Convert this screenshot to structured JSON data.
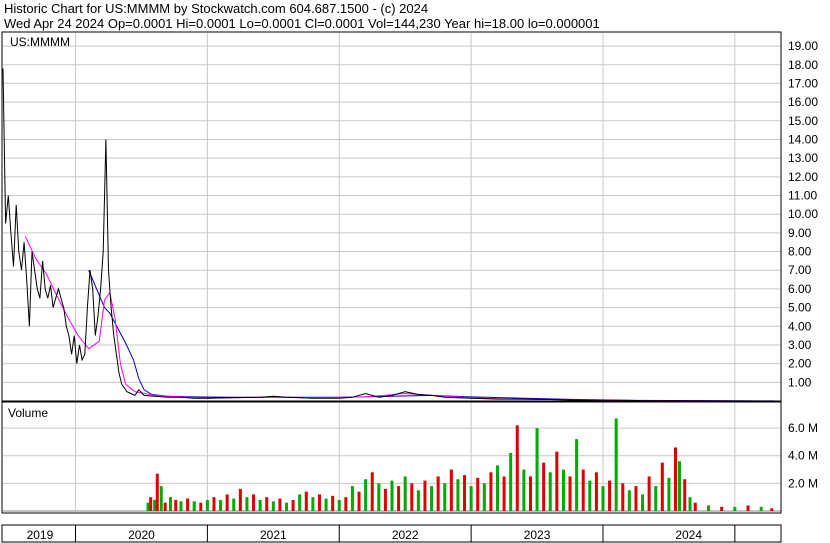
{
  "header": {
    "line1": "Historic Chart for US:MMMM by Stockwatch.com 604.687.1500 - (c) 2024",
    "line2": "Wed Apr 24 2024   Op=0.0001  Hi=0.0001  Lo=0.0001  Cl=0.0001  Vol=144,230   Year hi=18.00   lo=0.000001"
  },
  "chart_data": {
    "type": "line",
    "symbol_label": "US:MMMM",
    "volume_label": "Volume",
    "colors": {
      "price": "#000000",
      "ma_short": "#ff00ff",
      "ma_long": "#0000cc",
      "volume_up": "#00aa00",
      "volume_down": "#dd0000",
      "grid": "#c8c8c8"
    },
    "price_axis": {
      "ylim": [
        0,
        19.7
      ],
      "ticks": [
        "19.00",
        "18.00",
        "17.00",
        "16.00",
        "15.00",
        "14.00",
        "13.00",
        "12.00",
        "11.00",
        "10.00",
        "9.00",
        "8.00",
        "7.00",
        "6.00",
        "5.00",
        "4.00",
        "3.00",
        "2.00",
        "1.00"
      ],
      "tick_values": [
        19,
        18,
        17,
        16,
        15,
        14,
        13,
        12,
        11,
        10,
        9,
        8,
        7,
        6,
        5,
        4,
        3,
        2,
        1
      ]
    },
    "volume_axis": {
      "ylim": [
        0,
        7.6
      ],
      "unit": "M",
      "ticks": [
        "6.0 M",
        "4.0 M",
        "2.0 M"
      ],
      "tick_values": [
        6,
        4,
        2
      ]
    },
    "x_axis": {
      "xlim": [
        2018.45,
        2024.35
      ],
      "year_boundaries": [
        2019.0,
        2020.0,
        2021.0,
        2022.0,
        2023.0,
        2024.0
      ],
      "year_labels": [
        "2019",
        "2020",
        "2021",
        "2022",
        "2023",
        "2024"
      ],
      "label_positions": [
        2018.73,
        2019.5,
        2020.5,
        2021.5,
        2022.5,
        2023.65
      ]
    },
    "close_series": [
      [
        2018.45,
        17.8
      ],
      [
        2018.47,
        9.5
      ],
      [
        2018.49,
        11.0
      ],
      [
        2018.51,
        9.0
      ],
      [
        2018.53,
        7.2
      ],
      [
        2018.55,
        10.5
      ],
      [
        2018.57,
        8.0
      ],
      [
        2018.59,
        7.0
      ],
      [
        2018.61,
        8.5
      ],
      [
        2018.63,
        6.5
      ],
      [
        2018.65,
        4.0
      ],
      [
        2018.67,
        8.0
      ],
      [
        2018.69,
        7.0
      ],
      [
        2018.71,
        6.0
      ],
      [
        2018.73,
        5.5
      ],
      [
        2018.75,
        7.5
      ],
      [
        2018.77,
        6.0
      ],
      [
        2018.79,
        5.5
      ],
      [
        2018.81,
        6.2
      ],
      [
        2018.83,
        5.0
      ],
      [
        2018.85,
        5.5
      ],
      [
        2018.87,
        6.0
      ],
      [
        2018.89,
        5.5
      ],
      [
        2018.91,
        5.0
      ],
      [
        2018.93,
        4.0
      ],
      [
        2018.95,
        3.5
      ],
      [
        2018.97,
        2.5
      ],
      [
        2018.99,
        3.5
      ],
      [
        2019.01,
        2.0
      ],
      [
        2019.03,
        3.0
      ],
      [
        2019.05,
        2.2
      ],
      [
        2019.07,
        2.5
      ],
      [
        2019.09,
        5.0
      ],
      [
        2019.11,
        7.0
      ],
      [
        2019.13,
        6.0
      ],
      [
        2019.15,
        3.5
      ],
      [
        2019.17,
        4.5
      ],
      [
        2019.19,
        6.0
      ],
      [
        2019.21,
        8.0
      ],
      [
        2019.23,
        14.0
      ],
      [
        2019.25,
        7.0
      ],
      [
        2019.27,
        5.0
      ],
      [
        2019.29,
        3.5
      ],
      [
        2019.31,
        2.5
      ],
      [
        2019.33,
        1.5
      ],
      [
        2019.35,
        0.9
      ],
      [
        2019.37,
        0.7
      ],
      [
        2019.39,
        0.5
      ],
      [
        2019.42,
        0.4
      ],
      [
        2019.45,
        0.3
      ],
      [
        2019.48,
        0.6
      ],
      [
        2019.52,
        0.3
      ],
      [
        2019.6,
        0.25
      ],
      [
        2019.7,
        0.2
      ],
      [
        2019.8,
        0.2
      ],
      [
        2019.9,
        0.15
      ],
      [
        2020.0,
        0.15
      ],
      [
        2020.2,
        0.18
      ],
      [
        2020.4,
        0.2
      ],
      [
        2020.5,
        0.25
      ],
      [
        2020.6,
        0.2
      ],
      [
        2020.8,
        0.15
      ],
      [
        2021.0,
        0.15
      ],
      [
        2021.1,
        0.2
      ],
      [
        2021.2,
        0.4
      ],
      [
        2021.3,
        0.2
      ],
      [
        2021.4,
        0.3
      ],
      [
        2021.5,
        0.5
      ],
      [
        2021.6,
        0.35
      ],
      [
        2021.7,
        0.3
      ],
      [
        2021.8,
        0.2
      ],
      [
        2022.0,
        0.15
      ],
      [
        2022.2,
        0.1
      ],
      [
        2022.4,
        0.1
      ],
      [
        2022.6,
        0.08
      ],
      [
        2022.8,
        0.05
      ],
      [
        2023.0,
        0.04
      ],
      [
        2023.3,
        0.02
      ],
      [
        2023.6,
        0.01
      ],
      [
        2024.0,
        0.001
      ],
      [
        2024.3,
        0.0001
      ]
    ],
    "ma_short_series": [
      [
        2018.62,
        8.8
      ],
      [
        2018.7,
        7.6
      ],
      [
        2018.78,
        6.8
      ],
      [
        2018.86,
        5.6
      ],
      [
        2018.94,
        4.5
      ],
      [
        2019.02,
        3.5
      ],
      [
        2019.1,
        2.8
      ],
      [
        2019.18,
        3.2
      ],
      [
        2019.22,
        5.4
      ],
      [
        2019.26,
        5.8
      ],
      [
        2019.3,
        4.4
      ],
      [
        2019.34,
        2.0
      ],
      [
        2019.38,
        0.9
      ],
      [
        2019.45,
        0.5
      ],
      [
        2019.6,
        0.3
      ],
      [
        2019.8,
        0.22
      ],
      [
        2020.0,
        0.15
      ],
      [
        2020.4,
        0.2
      ],
      [
        2020.8,
        0.18
      ],
      [
        2021.2,
        0.22
      ],
      [
        2021.5,
        0.4
      ],
      [
        2021.8,
        0.25
      ],
      [
        2022.2,
        0.12
      ],
      [
        2022.6,
        0.08
      ],
      [
        2023.0,
        0.04
      ],
      [
        2023.6,
        0.01
      ],
      [
        2024.3,
        0.001
      ]
    ],
    "ma_long_series": [
      [
        2019.1,
        7.0
      ],
      [
        2019.16,
        6.0
      ],
      [
        2019.22,
        5.0
      ],
      [
        2019.26,
        4.7
      ],
      [
        2019.32,
        3.9
      ],
      [
        2019.38,
        3.1
      ],
      [
        2019.44,
        2.2
      ],
      [
        2019.48,
        1.2
      ],
      [
        2019.52,
        0.6
      ],
      [
        2019.58,
        0.35
      ],
      [
        2019.7,
        0.25
      ],
      [
        2019.9,
        0.22
      ],
      [
        2020.2,
        0.2
      ],
      [
        2020.6,
        0.2
      ],
      [
        2021.0,
        0.2
      ],
      [
        2021.4,
        0.25
      ],
      [
        2021.7,
        0.3
      ],
      [
        2022.0,
        0.22
      ],
      [
        2022.4,
        0.15
      ],
      [
        2022.8,
        0.08
      ],
      [
        2023.2,
        0.04
      ],
      [
        2023.8,
        0.02
      ],
      [
        2024.3,
        0.005
      ]
    ],
    "volume_series": [
      [
        2019.55,
        0.6,
        "up"
      ],
      [
        2019.57,
        1.0,
        "down"
      ],
      [
        2019.6,
        0.8,
        "up"
      ],
      [
        2019.62,
        2.7,
        "down"
      ],
      [
        2019.65,
        1.8,
        "up"
      ],
      [
        2019.68,
        0.6,
        "down"
      ],
      [
        2019.72,
        1.0,
        "up"
      ],
      [
        2019.76,
        0.8,
        "down"
      ],
      [
        2019.8,
        0.7,
        "up"
      ],
      [
        2019.85,
        0.9,
        "down"
      ],
      [
        2019.9,
        0.7,
        "up"
      ],
      [
        2019.95,
        0.6,
        "down"
      ],
      [
        2020.0,
        0.8,
        "up"
      ],
      [
        2020.05,
        1.0,
        "down"
      ],
      [
        2020.1,
        0.8,
        "up"
      ],
      [
        2020.15,
        1.2,
        "down"
      ],
      [
        2020.2,
        0.9,
        "up"
      ],
      [
        2020.25,
        1.6,
        "down"
      ],
      [
        2020.3,
        1.0,
        "up"
      ],
      [
        2020.35,
        1.2,
        "down"
      ],
      [
        2020.4,
        0.8,
        "up"
      ],
      [
        2020.45,
        1.0,
        "down"
      ],
      [
        2020.5,
        0.7,
        "up"
      ],
      [
        2020.55,
        0.9,
        "down"
      ],
      [
        2020.6,
        0.6,
        "up"
      ],
      [
        2020.65,
        0.8,
        "down"
      ],
      [
        2020.7,
        1.2,
        "up"
      ],
      [
        2020.75,
        1.4,
        "down"
      ],
      [
        2020.8,
        1.0,
        "up"
      ],
      [
        2020.85,
        1.2,
        "down"
      ],
      [
        2020.9,
        0.9,
        "up"
      ],
      [
        2020.95,
        1.1,
        "down"
      ],
      [
        2021.0,
        0.8,
        "up"
      ],
      [
        2021.05,
        1.0,
        "down"
      ],
      [
        2021.1,
        1.8,
        "up"
      ],
      [
        2021.15,
        1.4,
        "down"
      ],
      [
        2021.2,
        2.3,
        "up"
      ],
      [
        2021.25,
        2.8,
        "down"
      ],
      [
        2021.3,
        2.0,
        "up"
      ],
      [
        2021.35,
        1.6,
        "down"
      ],
      [
        2021.4,
        2.2,
        "up"
      ],
      [
        2021.45,
        1.8,
        "down"
      ],
      [
        2021.5,
        2.5,
        "up"
      ],
      [
        2021.55,
        2.0,
        "down"
      ],
      [
        2021.6,
        1.5,
        "up"
      ],
      [
        2021.65,
        2.2,
        "down"
      ],
      [
        2021.7,
        1.8,
        "up"
      ],
      [
        2021.75,
        2.5,
        "down"
      ],
      [
        2021.8,
        2.0,
        "up"
      ],
      [
        2021.85,
        3.0,
        "down"
      ],
      [
        2021.9,
        2.3,
        "up"
      ],
      [
        2021.95,
        2.6,
        "down"
      ],
      [
        2022.0,
        1.8,
        "up"
      ],
      [
        2022.05,
        2.4,
        "down"
      ],
      [
        2022.1,
        2.0,
        "up"
      ],
      [
        2022.15,
        2.8,
        "down"
      ],
      [
        2022.2,
        3.3,
        "up"
      ],
      [
        2022.25,
        2.5,
        "down"
      ],
      [
        2022.3,
        4.2,
        "up"
      ],
      [
        2022.35,
        6.2,
        "down"
      ],
      [
        2022.4,
        3.0,
        "up"
      ],
      [
        2022.45,
        2.5,
        "down"
      ],
      [
        2022.5,
        6.0,
        "up"
      ],
      [
        2022.55,
        3.5,
        "down"
      ],
      [
        2022.6,
        2.8,
        "up"
      ],
      [
        2022.65,
        4.3,
        "down"
      ],
      [
        2022.7,
        3.0,
        "up"
      ],
      [
        2022.75,
        2.5,
        "down"
      ],
      [
        2022.8,
        5.2,
        "up"
      ],
      [
        2022.85,
        3.0,
        "down"
      ],
      [
        2022.9,
        2.2,
        "up"
      ],
      [
        2022.95,
        2.8,
        "down"
      ],
      [
        2023.0,
        1.8,
        "up"
      ],
      [
        2023.05,
        2.2,
        "down"
      ],
      [
        2023.1,
        6.7,
        "up"
      ],
      [
        2023.15,
        2.0,
        "down"
      ],
      [
        2023.2,
        1.5,
        "up"
      ],
      [
        2023.25,
        1.8,
        "down"
      ],
      [
        2023.3,
        1.2,
        "up"
      ],
      [
        2023.35,
        2.5,
        "down"
      ],
      [
        2023.4,
        1.8,
        "up"
      ],
      [
        2023.45,
        3.5,
        "down"
      ],
      [
        2023.5,
        2.4,
        "up"
      ],
      [
        2023.55,
        4.6,
        "down"
      ],
      [
        2023.58,
        3.6,
        "up"
      ],
      [
        2023.62,
        2.3,
        "down"
      ],
      [
        2023.66,
        1.0,
        "up"
      ],
      [
        2023.7,
        0.6,
        "down"
      ],
      [
        2023.8,
        0.4,
        "up"
      ],
      [
        2023.9,
        0.3,
        "down"
      ],
      [
        2024.0,
        0.3,
        "up"
      ],
      [
        2024.1,
        0.4,
        "down"
      ],
      [
        2024.2,
        0.3,
        "up"
      ],
      [
        2024.28,
        0.2,
        "down"
      ]
    ]
  }
}
